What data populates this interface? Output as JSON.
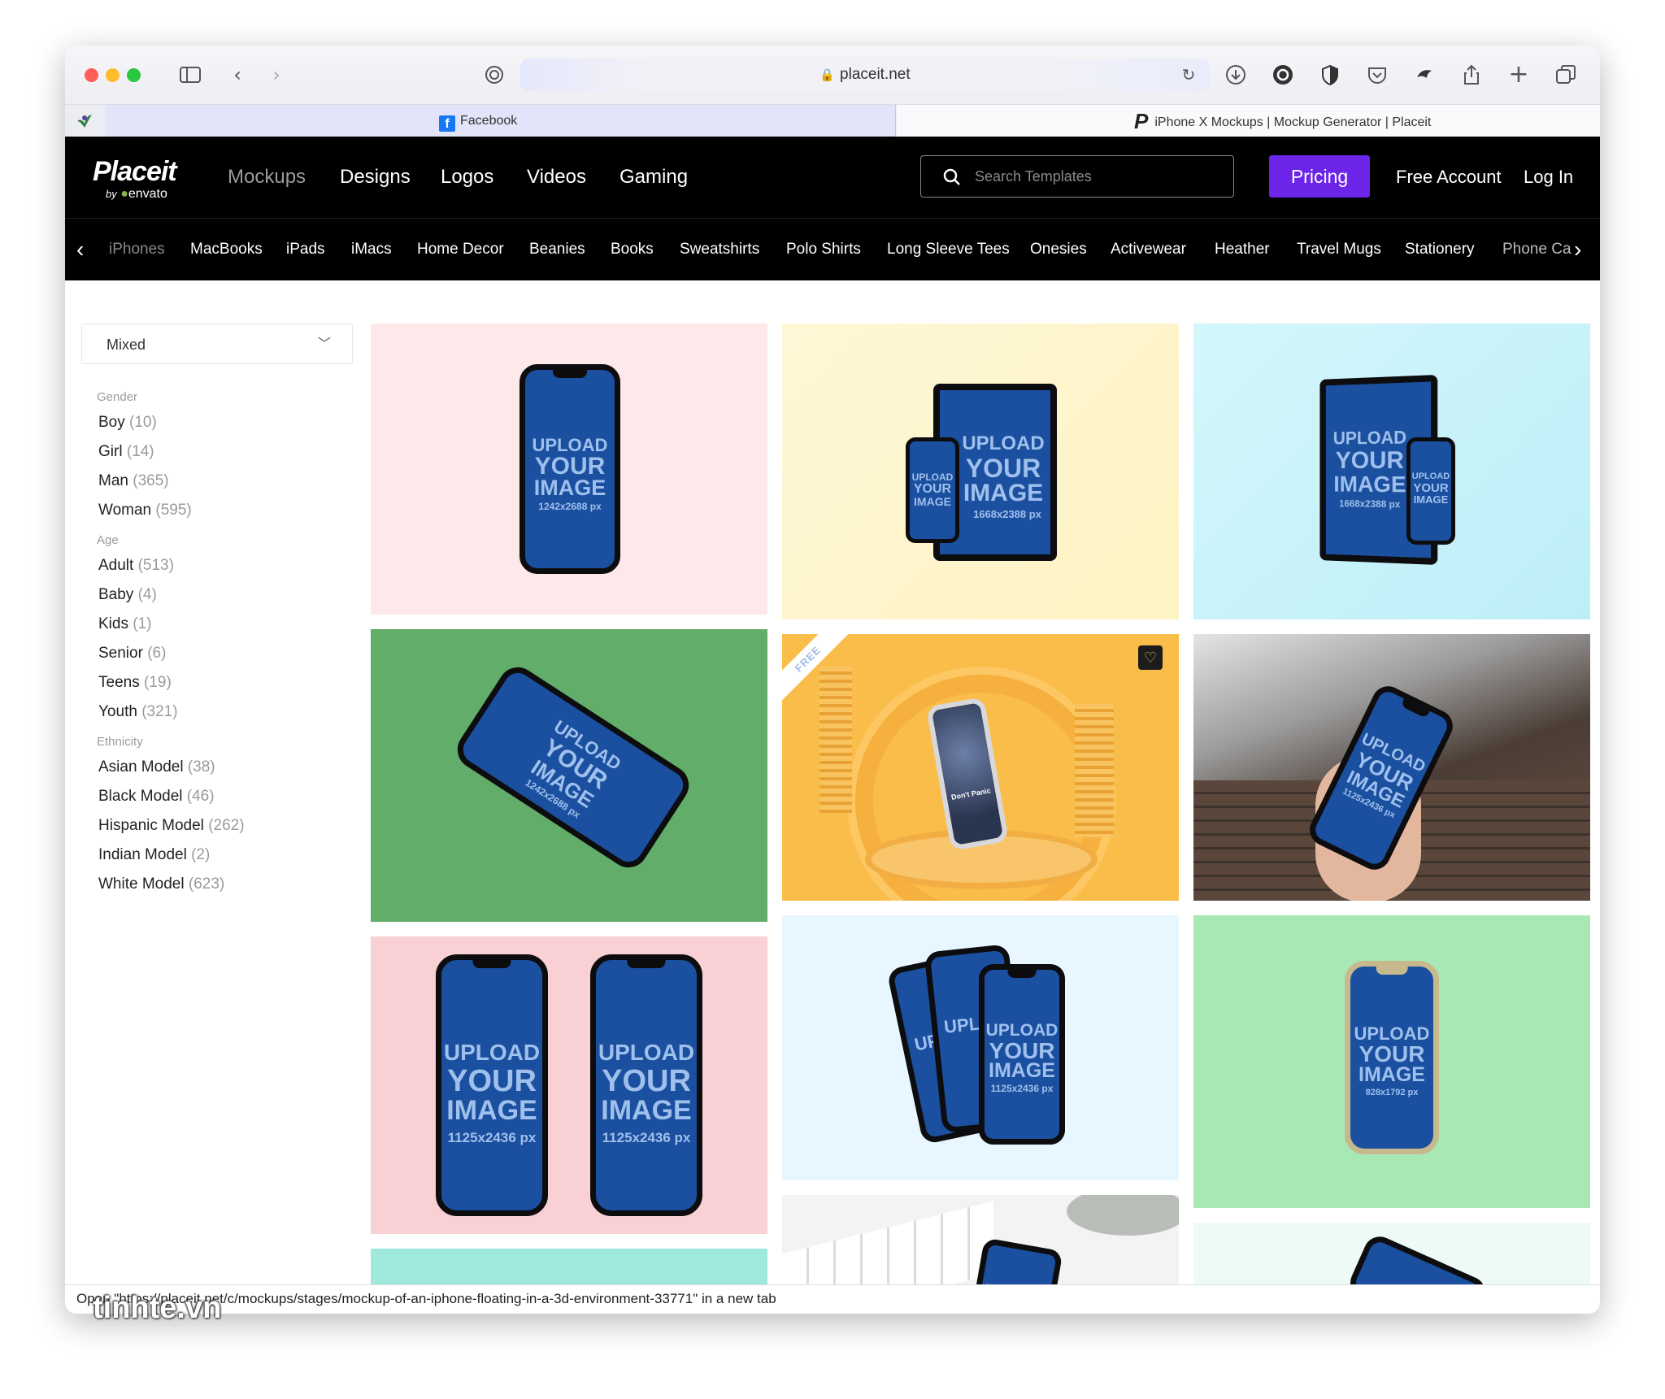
{
  "browser": {
    "url": "placeit.net",
    "tabs": [
      {
        "label": "Facebook"
      },
      {
        "label": "iPhone X Mockups | Mockup Generator | Placeit"
      }
    ]
  },
  "nav": {
    "logo": "Placeit",
    "logo_by": "by",
    "logo_brand": "envato",
    "links": [
      "Mockups",
      "Designs",
      "Logos",
      "Videos",
      "Gaming"
    ],
    "search_placeholder": "Search Templates",
    "pricing": "Pricing",
    "free_account": "Free Account",
    "login": "Log In"
  },
  "categories": [
    "iPhones",
    "MacBooks",
    "iPads",
    "iMacs",
    "Home Decor",
    "Beanies",
    "Books",
    "Sweatshirts",
    "Polo Shirts",
    "Long Sleeve Tees",
    "Onesies",
    "Activewear",
    "Heather",
    "Travel Mugs",
    "Stationery",
    "Phone Ca"
  ],
  "sidebar": {
    "select_value": "Mixed",
    "gender_title": "Gender",
    "gender": [
      {
        "label": "Boy",
        "count": "(10)"
      },
      {
        "label": "Girl",
        "count": "(14)"
      },
      {
        "label": "Man",
        "count": "(365)"
      },
      {
        "label": "Woman",
        "count": "(595)"
      }
    ],
    "age_title": "Age",
    "age": [
      {
        "label": "Adult",
        "count": "(513)"
      },
      {
        "label": "Baby",
        "count": "(4)"
      },
      {
        "label": "Kids",
        "count": "(1)"
      },
      {
        "label": "Senior",
        "count": "(6)"
      },
      {
        "label": "Teens",
        "count": "(19)"
      },
      {
        "label": "Youth",
        "count": "(321)"
      }
    ],
    "ethnicity_title": "Ethnicity",
    "ethnicity": [
      {
        "label": "Asian Model",
        "count": "(38)"
      },
      {
        "label": "Black Model",
        "count": "(46)"
      },
      {
        "label": "Hispanic Model",
        "count": "(262)"
      },
      {
        "label": "Indian Model",
        "count": "(2)"
      },
      {
        "label": "White Model",
        "count": "(623)"
      }
    ]
  },
  "mockups": {
    "upload": "UPLOAD",
    "your": "YOUR",
    "image": "IMAGE",
    "dims_1242": "1242x2688 px",
    "dims_1668": "1668x2388 px",
    "dims_1125": "1125x2436 px",
    "dims_828": "828x1792 px",
    "free_badge": "FREE",
    "dont_panic": "Don't Panic"
  },
  "status_bar": "Open \"https://placeit.net/c/mockups/stages/mockup-of-an-iphone-floating-in-a-3d-environment-33771\" in a new tab",
  "watermark": "tinhte.vn",
  "colors": {
    "pricing": "#6b24e8",
    "nav_bg": "#000000",
    "screen": "#1b4f9f"
  }
}
